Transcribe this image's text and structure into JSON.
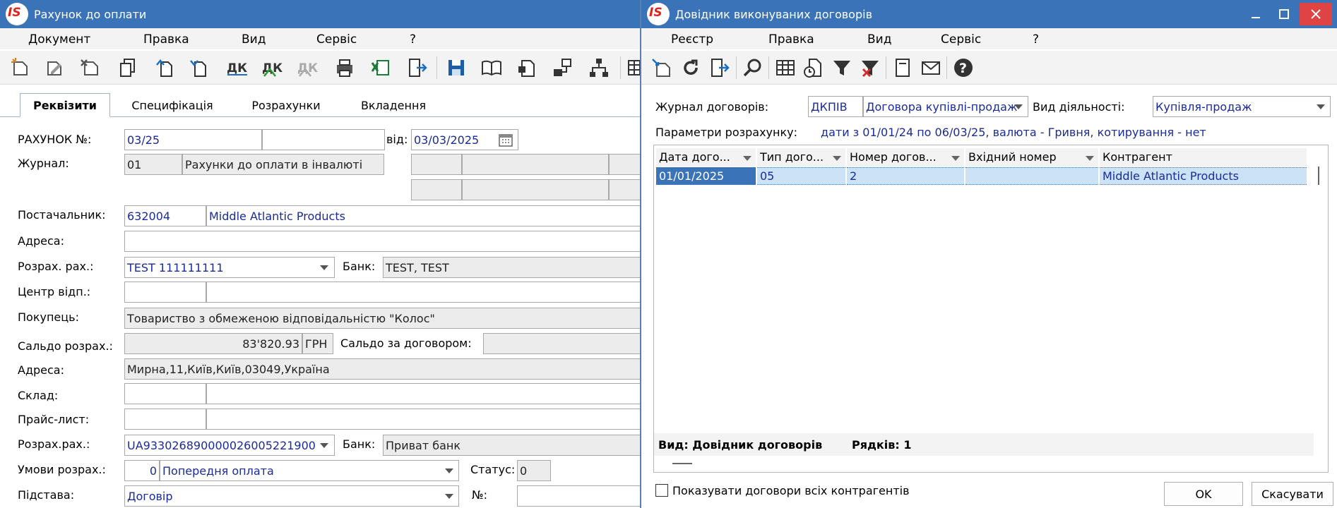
{
  "left_window": {
    "title": "Рахунок до оплати",
    "menu": [
      "Документ",
      "Правка",
      "Вид",
      "Сервіс",
      "?"
    ],
    "tabs": [
      "Реквізити",
      "Специфікація",
      "Розрахунки",
      "Вкладення"
    ],
    "labels": {
      "invoice_no": "РАХУНОК №:",
      "from": "від:",
      "journal": "Журнал:",
      "supplier": "Постачальник:",
      "address": "Адреса:",
      "settlement_account": "Розрах. рах.:",
      "bank": "Банк:",
      "responsibility_center": "Центр відп.:",
      "buyer": "Покупець:",
      "balance": "Сальдо розрах.:",
      "contract_balance": "Сальдо за договором:",
      "address2": "Адреса:",
      "warehouse": "Склад:",
      "price_list": "Прайс-лист:",
      "settlement_account2": "Розрах.рах.:",
      "bank2": "Банк:",
      "payment_terms": "Умови розрах.:",
      "status": "Статус:",
      "basis": "Підстава:",
      "number": "№:"
    },
    "values": {
      "invoice_no": "03/25",
      "date": "03/03/2025",
      "journal_code": "01",
      "journal_name": "Рахунки до оплати в інвалюті",
      "supplier_code": "632004",
      "supplier_name": "Middle Atlantic Products",
      "settlement_account": "TEST 111111111",
      "bank": "TEST, TEST",
      "buyer": "Товариство з обмеженою відповідальністю \"Колос\"",
      "balance": "83'820.93",
      "currency": "ГРН",
      "address2": "Мирна,11,Київ,Київ,03049,Україна",
      "settlement_account2": "UA933026890000026005221900",
      "bank2": "Приват банк",
      "payment_terms_code": "0",
      "payment_terms_name": "Попередня оплата",
      "status": "0",
      "basis": "Договір"
    }
  },
  "right_window": {
    "title": "Довідник виконуваних договорів",
    "menu": [
      "Реєстр",
      "Правка",
      "Вид",
      "Сервіс",
      "?"
    ],
    "labels": {
      "journal": "Журнал договорів:",
      "activity": "Вид діяльності:",
      "calc_params": "Параметри розрахунку:"
    },
    "values": {
      "journal_code": "ДКПІВ",
      "journal_name": "Договора купівлі-продаж",
      "activity": "Купівля-продаж",
      "calc_params": "дати з 01/01/24 по 06/03/25, валюта - Гривня, котирування - нет"
    },
    "grid": {
      "columns": [
        "Дата дого...",
        "Тип дого...",
        "Номер догов...",
        "Вхідний номер",
        "Контрагент"
      ],
      "rows": [
        [
          "01/01/2025",
          "05",
          "2",
          "",
          "Middle Atlantic Products"
        ]
      ]
    },
    "footer": {
      "view": "Вид: Довідник договорів",
      "rows": "Рядків: 1"
    },
    "checkbox_label": "Показувати договори всіх контрагентів",
    "ok": "OK",
    "cancel": "Скасувати"
  }
}
